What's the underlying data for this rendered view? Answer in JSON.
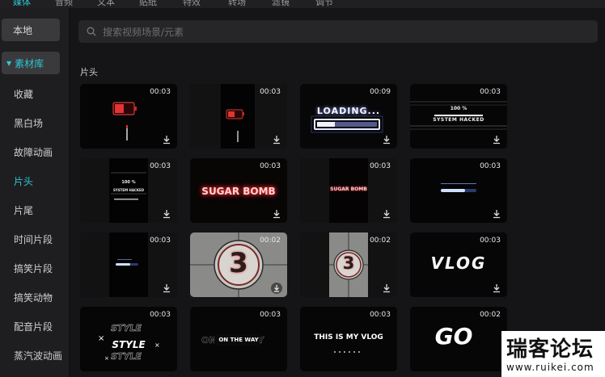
{
  "top_tabs": [
    {
      "label": "媒体",
      "active": true
    },
    {
      "label": "音频",
      "active": false
    },
    {
      "label": "文本",
      "active": false
    },
    {
      "label": "贴纸",
      "active": false
    },
    {
      "label": "特效",
      "active": false
    },
    {
      "label": "转场",
      "active": false
    },
    {
      "label": "滤镜",
      "active": false
    },
    {
      "label": "调节",
      "active": false
    }
  ],
  "sidebar": {
    "local_label": "本地",
    "library_label": "素材库",
    "items": [
      "收藏",
      "黑白场",
      "故障动画",
      "片头",
      "片尾",
      "时间片段",
      "搞笑片段",
      "搞笑动物",
      "配音片段",
      "蒸汽波动画"
    ],
    "active_index": 3
  },
  "search": {
    "placeholder": "搜索视频场景/元素"
  },
  "section_title": "片头",
  "cards": [
    {
      "duration": "00:03",
      "kind": "battery-red"
    },
    {
      "duration": "00:03",
      "kind": "battery-small"
    },
    {
      "duration": "00:09",
      "kind": "loading",
      "text": "LOADING..."
    },
    {
      "duration": "00:03",
      "kind": "hacked",
      "text": "100 %",
      "text2": "SYSTEM HACKED"
    },
    {
      "duration": "00:03",
      "kind": "hacked-small",
      "text": "100 %",
      "text2": "SYSTEM HACKED"
    },
    {
      "duration": "00:03",
      "kind": "sugar-big",
      "text": "SUGAR BOMB"
    },
    {
      "duration": "00:03",
      "kind": "sugar-small",
      "text": "SUGAR BOMB"
    },
    {
      "duration": "00:03",
      "kind": "progress-blue"
    },
    {
      "duration": "00:03",
      "kind": "progress-small"
    },
    {
      "duration": "00:02",
      "kind": "countdown-big",
      "text": "3"
    },
    {
      "duration": "00:02",
      "kind": "countdown-small",
      "text": "3"
    },
    {
      "duration": "00:03",
      "kind": "vlog",
      "text": "VLOG"
    },
    {
      "duration": "00:03",
      "kind": "style",
      "text": "STYLE"
    },
    {
      "duration": "00:03",
      "kind": "ontheway",
      "text": "ON THE WAY"
    },
    {
      "duration": "00:03",
      "kind": "mylog",
      "text": "THIS IS MY VLOG"
    },
    {
      "duration": "00:02",
      "kind": "go",
      "text": "GO"
    }
  ],
  "watermark": {
    "big": "瑞客论坛",
    "small": "www.ruikei.com"
  },
  "colors": {
    "accent": "#2fc7d6",
    "card_bg": "#0b0b0c",
    "sidebar_bg": "#1e1e20"
  }
}
